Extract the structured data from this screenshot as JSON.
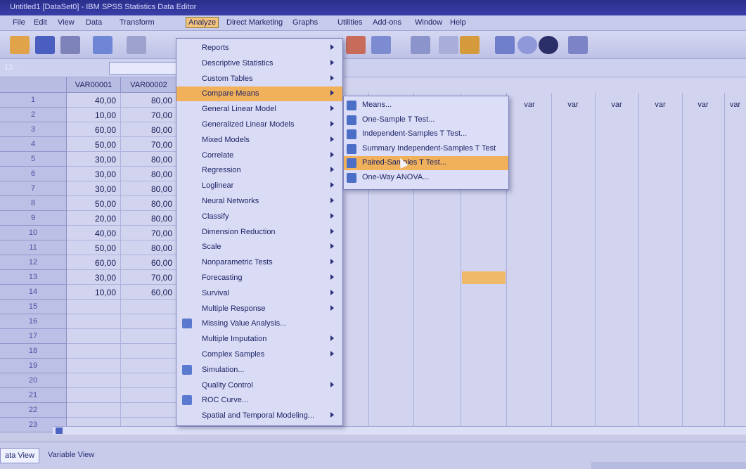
{
  "title": "Untitled1 [DataSet0] - IBM SPSS Statistics Data Editor",
  "menubar": [
    "File",
    "Edit",
    "View",
    "Data",
    "Transform",
    "Analyze",
    "Direct Marketing",
    "Graphs",
    "Utilities",
    "Add-ons",
    "Window",
    "Help"
  ],
  "cell_reference": "13 :",
  "columns": [
    "VAR00001",
    "VAR00002",
    "var",
    "var",
    "var",
    "var",
    "var",
    "var"
  ],
  "rows": [
    {
      "n": "1",
      "a": "40,00",
      "b": "80,00"
    },
    {
      "n": "2",
      "a": "10,00",
      "b": "70,00"
    },
    {
      "n": "3",
      "a": "60,00",
      "b": "80,00"
    },
    {
      "n": "4",
      "a": "50,00",
      "b": "70,00"
    },
    {
      "n": "5",
      "a": "30,00",
      "b": "80,00"
    },
    {
      "n": "6",
      "a": "30,00",
      "b": "80,00"
    },
    {
      "n": "7",
      "a": "30,00",
      "b": "80,00"
    },
    {
      "n": "8",
      "a": "50,00",
      "b": "80,00"
    },
    {
      "n": "9",
      "a": "20,00",
      "b": "80,00"
    },
    {
      "n": "10",
      "a": "40,00",
      "b": "70,00"
    },
    {
      "n": "11",
      "a": "50,00",
      "b": "80,00"
    },
    {
      "n": "12",
      "a": "60,00",
      "b": "60,00"
    },
    {
      "n": "13",
      "a": "30,00",
      "b": "70,00"
    },
    {
      "n": "14",
      "a": "10,00",
      "b": "60,00"
    },
    {
      "n": "15",
      "a": "",
      "b": ""
    },
    {
      "n": "16",
      "a": "",
      "b": ""
    },
    {
      "n": "17",
      "a": "",
      "b": ""
    },
    {
      "n": "18",
      "a": "",
      "b": ""
    },
    {
      "n": "19",
      "a": "",
      "b": ""
    },
    {
      "n": "20",
      "a": "",
      "b": ""
    },
    {
      "n": "21",
      "a": "",
      "b": ""
    },
    {
      "n": "22",
      "a": "",
      "b": ""
    },
    {
      "n": "23",
      "a": "",
      "b": ""
    }
  ],
  "analyze_menu": [
    {
      "label": "Reports",
      "submenu": true
    },
    {
      "label": "Descriptive Statistics",
      "submenu": true
    },
    {
      "label": "Custom Tables",
      "submenu": true
    },
    {
      "label": "Compare Means",
      "submenu": true,
      "highlighted": true
    },
    {
      "label": "General Linear Model",
      "submenu": true
    },
    {
      "label": "Generalized Linear Models",
      "submenu": true
    },
    {
      "label": "Mixed Models",
      "submenu": true
    },
    {
      "label": "Correlate",
      "submenu": true
    },
    {
      "label": "Regression",
      "submenu": true
    },
    {
      "label": "Loglinear",
      "submenu": true
    },
    {
      "label": "Neural Networks",
      "submenu": true
    },
    {
      "label": "Classify",
      "submenu": true
    },
    {
      "label": "Dimension Reduction",
      "submenu": true
    },
    {
      "label": "Scale",
      "submenu": true
    },
    {
      "label": "Nonparametric Tests",
      "submenu": true
    },
    {
      "label": "Forecasting",
      "submenu": true
    },
    {
      "label": "Survival",
      "submenu": true
    },
    {
      "label": "Multiple Response",
      "submenu": true
    },
    {
      "label": "Missing Value Analysis...",
      "submenu": false,
      "icon": true
    },
    {
      "label": "Multiple Imputation",
      "submenu": true
    },
    {
      "label": "Complex Samples",
      "submenu": true
    },
    {
      "label": "Simulation...",
      "submenu": false,
      "icon": true
    },
    {
      "label": "Quality Control",
      "submenu": true
    },
    {
      "label": "ROC Curve...",
      "submenu": false,
      "icon": true
    },
    {
      "label": "Spatial and Temporal Modeling...",
      "submenu": true
    }
  ],
  "compare_means_submenu": [
    {
      "label": "Means..."
    },
    {
      "label": "One-Sample T Test..."
    },
    {
      "label": "Independent-Samples T Test..."
    },
    {
      "label": "Summary Independent-Samples T Test"
    },
    {
      "label": "Paired-Samples T Test...",
      "highlighted": true
    },
    {
      "label": "One-Way ANOVA..."
    }
  ],
  "tabs": {
    "data_view": "ata View",
    "variable_view": "Variable View"
  },
  "colors": {
    "highlight": "#f0b15a",
    "menu_bg": "#dadcf6"
  }
}
